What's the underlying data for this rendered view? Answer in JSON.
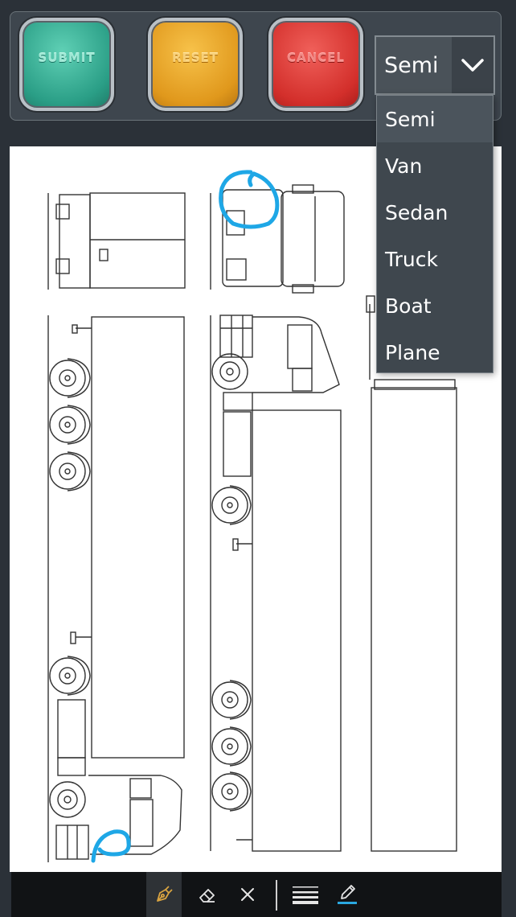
{
  "buttons": {
    "submit": "SUBMIT",
    "reset": "RESET",
    "cancel": "CANCEL"
  },
  "vehicle_select": {
    "selected": "Semi",
    "options": [
      "Semi",
      "Van",
      "Sedan",
      "Truck",
      "Boat",
      "Plane"
    ]
  },
  "tools": {
    "icons": [
      "pen-icon",
      "eraser-icon",
      "clear-icon",
      "line-width-icon",
      "color-icon"
    ],
    "active": "pen-icon",
    "color_accent": "#2aa8e0"
  },
  "annotation_color": "#1ea7e6"
}
